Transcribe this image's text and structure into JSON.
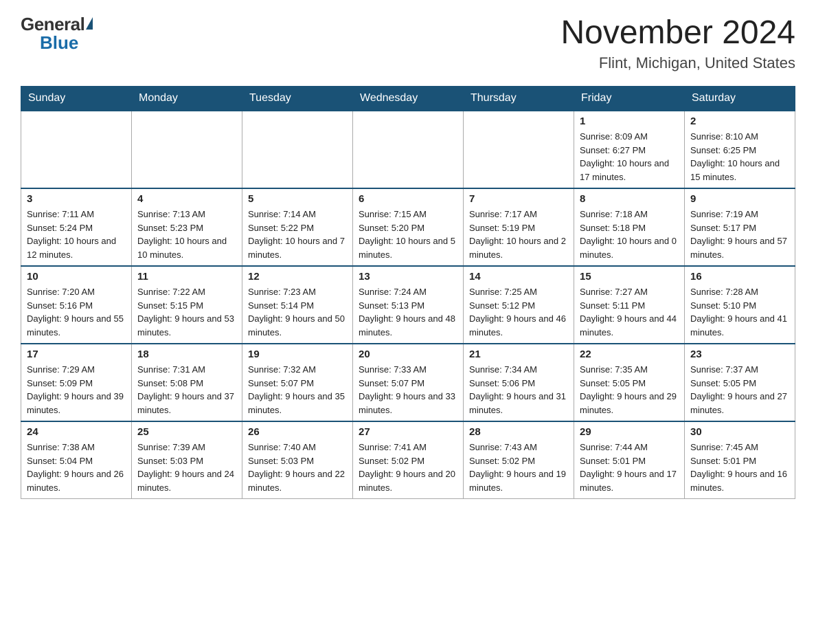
{
  "logo": {
    "general": "General",
    "blue": "Blue"
  },
  "title": "November 2024",
  "location": "Flint, Michigan, United States",
  "days_of_week": [
    "Sunday",
    "Monday",
    "Tuesday",
    "Wednesday",
    "Thursday",
    "Friday",
    "Saturday"
  ],
  "weeks": [
    [
      {
        "day": "",
        "info": ""
      },
      {
        "day": "",
        "info": ""
      },
      {
        "day": "",
        "info": ""
      },
      {
        "day": "",
        "info": ""
      },
      {
        "day": "",
        "info": ""
      },
      {
        "day": "1",
        "info": "Sunrise: 8:09 AM\nSunset: 6:27 PM\nDaylight: 10 hours\nand 17 minutes."
      },
      {
        "day": "2",
        "info": "Sunrise: 8:10 AM\nSunset: 6:25 PM\nDaylight: 10 hours\nand 15 minutes."
      }
    ],
    [
      {
        "day": "3",
        "info": "Sunrise: 7:11 AM\nSunset: 5:24 PM\nDaylight: 10 hours\nand 12 minutes."
      },
      {
        "day": "4",
        "info": "Sunrise: 7:13 AM\nSunset: 5:23 PM\nDaylight: 10 hours\nand 10 minutes."
      },
      {
        "day": "5",
        "info": "Sunrise: 7:14 AM\nSunset: 5:22 PM\nDaylight: 10 hours\nand 7 minutes."
      },
      {
        "day": "6",
        "info": "Sunrise: 7:15 AM\nSunset: 5:20 PM\nDaylight: 10 hours\nand 5 minutes."
      },
      {
        "day": "7",
        "info": "Sunrise: 7:17 AM\nSunset: 5:19 PM\nDaylight: 10 hours\nand 2 minutes."
      },
      {
        "day": "8",
        "info": "Sunrise: 7:18 AM\nSunset: 5:18 PM\nDaylight: 10 hours\nand 0 minutes."
      },
      {
        "day": "9",
        "info": "Sunrise: 7:19 AM\nSunset: 5:17 PM\nDaylight: 9 hours\nand 57 minutes."
      }
    ],
    [
      {
        "day": "10",
        "info": "Sunrise: 7:20 AM\nSunset: 5:16 PM\nDaylight: 9 hours\nand 55 minutes."
      },
      {
        "day": "11",
        "info": "Sunrise: 7:22 AM\nSunset: 5:15 PM\nDaylight: 9 hours\nand 53 minutes."
      },
      {
        "day": "12",
        "info": "Sunrise: 7:23 AM\nSunset: 5:14 PM\nDaylight: 9 hours\nand 50 minutes."
      },
      {
        "day": "13",
        "info": "Sunrise: 7:24 AM\nSunset: 5:13 PM\nDaylight: 9 hours\nand 48 minutes."
      },
      {
        "day": "14",
        "info": "Sunrise: 7:25 AM\nSunset: 5:12 PM\nDaylight: 9 hours\nand 46 minutes."
      },
      {
        "day": "15",
        "info": "Sunrise: 7:27 AM\nSunset: 5:11 PM\nDaylight: 9 hours\nand 44 minutes."
      },
      {
        "day": "16",
        "info": "Sunrise: 7:28 AM\nSunset: 5:10 PM\nDaylight: 9 hours\nand 41 minutes."
      }
    ],
    [
      {
        "day": "17",
        "info": "Sunrise: 7:29 AM\nSunset: 5:09 PM\nDaylight: 9 hours\nand 39 minutes."
      },
      {
        "day": "18",
        "info": "Sunrise: 7:31 AM\nSunset: 5:08 PM\nDaylight: 9 hours\nand 37 minutes."
      },
      {
        "day": "19",
        "info": "Sunrise: 7:32 AM\nSunset: 5:07 PM\nDaylight: 9 hours\nand 35 minutes."
      },
      {
        "day": "20",
        "info": "Sunrise: 7:33 AM\nSunset: 5:07 PM\nDaylight: 9 hours\nand 33 minutes."
      },
      {
        "day": "21",
        "info": "Sunrise: 7:34 AM\nSunset: 5:06 PM\nDaylight: 9 hours\nand 31 minutes."
      },
      {
        "day": "22",
        "info": "Sunrise: 7:35 AM\nSunset: 5:05 PM\nDaylight: 9 hours\nand 29 minutes."
      },
      {
        "day": "23",
        "info": "Sunrise: 7:37 AM\nSunset: 5:05 PM\nDaylight: 9 hours\nand 27 minutes."
      }
    ],
    [
      {
        "day": "24",
        "info": "Sunrise: 7:38 AM\nSunset: 5:04 PM\nDaylight: 9 hours\nand 26 minutes."
      },
      {
        "day": "25",
        "info": "Sunrise: 7:39 AM\nSunset: 5:03 PM\nDaylight: 9 hours\nand 24 minutes."
      },
      {
        "day": "26",
        "info": "Sunrise: 7:40 AM\nSunset: 5:03 PM\nDaylight: 9 hours\nand 22 minutes."
      },
      {
        "day": "27",
        "info": "Sunrise: 7:41 AM\nSunset: 5:02 PM\nDaylight: 9 hours\nand 20 minutes."
      },
      {
        "day": "28",
        "info": "Sunrise: 7:43 AM\nSunset: 5:02 PM\nDaylight: 9 hours\nand 19 minutes."
      },
      {
        "day": "29",
        "info": "Sunrise: 7:44 AM\nSunset: 5:01 PM\nDaylight: 9 hours\nand 17 minutes."
      },
      {
        "day": "30",
        "info": "Sunrise: 7:45 AM\nSunset: 5:01 PM\nDaylight: 9 hours\nand 16 minutes."
      }
    ]
  ]
}
